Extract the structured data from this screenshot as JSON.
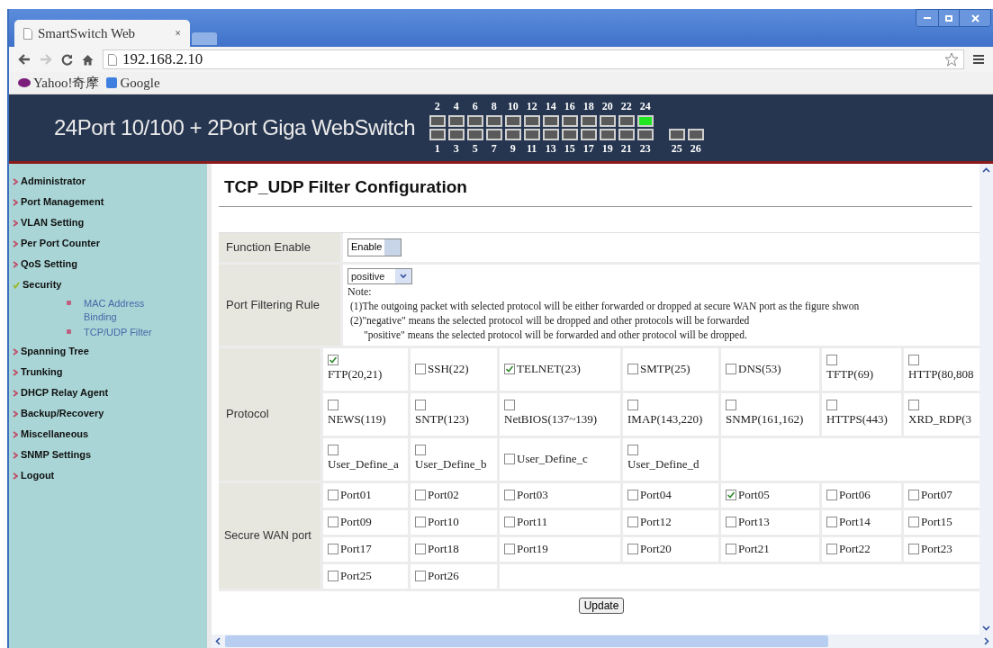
{
  "browser": {
    "tab_title": "SmartSwitch Web",
    "tab_close": "×",
    "url": "192.168.2.10",
    "bookmarks": [
      {
        "label": "Yahoo!奇摩",
        "kind": "yahoo"
      },
      {
        "label": "Google",
        "kind": "google"
      }
    ]
  },
  "banner": {
    "title": "24Port 10/100 + 2Port Giga WebSwitch",
    "ports_top": [
      {
        "label": "2",
        "up": false
      },
      {
        "label": "4",
        "up": false
      },
      {
        "label": "6",
        "up": false
      },
      {
        "label": "8",
        "up": false
      },
      {
        "label": "10",
        "up": false
      },
      {
        "label": "12",
        "up": false
      },
      {
        "label": "14",
        "up": false
      },
      {
        "label": "16",
        "up": false
      },
      {
        "label": "18",
        "up": false
      },
      {
        "label": "20",
        "up": false
      },
      {
        "label": "22",
        "up": false
      },
      {
        "label": "24",
        "up": true
      }
    ],
    "ports_bottom": [
      {
        "label": "1",
        "up": false
      },
      {
        "label": "3",
        "up": false
      },
      {
        "label": "5",
        "up": false
      },
      {
        "label": "7",
        "up": false
      },
      {
        "label": "9",
        "up": false
      },
      {
        "label": "11",
        "up": false
      },
      {
        "label": "13",
        "up": false
      },
      {
        "label": "15",
        "up": false
      },
      {
        "label": "17",
        "up": false
      },
      {
        "label": "19",
        "up": false
      },
      {
        "label": "21",
        "up": false
      },
      {
        "label": "23",
        "up": false
      }
    ],
    "ports_giga": [
      {
        "label": "25",
        "up": false
      },
      {
        "label": "26",
        "up": false
      }
    ]
  },
  "sidebar": {
    "items": [
      {
        "label": "Administrator",
        "expanded": false
      },
      {
        "label": "Port Management",
        "expanded": false
      },
      {
        "label": "VLAN Setting",
        "expanded": false
      },
      {
        "label": "Per Port Counter",
        "expanded": false
      },
      {
        "label": "QoS Setting",
        "expanded": false
      },
      {
        "label": "Security",
        "expanded": true,
        "children": [
          {
            "label": "MAC Address Binding"
          },
          {
            "label": "TCP/UDP Filter"
          }
        ]
      },
      {
        "label": "Spanning Tree",
        "expanded": false
      },
      {
        "label": "Trunking",
        "expanded": false
      },
      {
        "label": "DHCP Relay Agent",
        "expanded": false
      },
      {
        "label": "Backup/Recovery",
        "expanded": false
      },
      {
        "label": "Miscellaneous",
        "expanded": false
      },
      {
        "label": "SNMP Settings",
        "expanded": false
      },
      {
        "label": "Logout",
        "expanded": false
      }
    ]
  },
  "page_title": "TCP_UDP Filter Configuration",
  "function_enable": {
    "label": "Function Enable",
    "value": "Enable",
    "disabled": true
  },
  "port_filtering_rule": {
    "label": "Port Filtering Rule",
    "value": "positive",
    "note_title": "Note:",
    "notes": [
      "(1)The outgoing packet with selected protocol will be either forwarded or dropped at secure WAN port as the figure shwon",
      "(2)\"negative\" means the selected protocol will be dropped and other protocols will be forwarded",
      "\"positive\" means the selected protocol will be forwarded and other protocol will be dropped."
    ]
  },
  "protocol": {
    "label": "Protocol",
    "rows": [
      [
        {
          "label": "FTP(20,21)",
          "checked": true,
          "kind": "stacked"
        },
        {
          "label": "SSH(22)",
          "checked": false,
          "kind": "inline"
        },
        {
          "label": "TELNET(23)",
          "checked": true,
          "kind": "inline"
        },
        {
          "label": "SMTP(25)",
          "checked": false,
          "kind": "inline"
        },
        {
          "label": "DNS(53)",
          "checked": false,
          "kind": "inline"
        },
        {
          "label": "TFTP(69)",
          "checked": false,
          "kind": "stacked"
        },
        {
          "label": "HTTP(80,808",
          "checked": false,
          "kind": "stacked"
        }
      ],
      [
        {
          "label": "NEWS(119)",
          "checked": false,
          "kind": "stacked"
        },
        {
          "label": "SNTP(123)",
          "checked": false,
          "kind": "stacked"
        },
        {
          "label": "NetBIOS(137~139)",
          "checked": false,
          "kind": "stacked"
        },
        {
          "label": "IMAP(143,220)",
          "checked": false,
          "kind": "stacked"
        },
        {
          "label": "SNMP(161,162)",
          "checked": false,
          "kind": "stacked"
        },
        {
          "label": "HTTPS(443)",
          "checked": false,
          "kind": "stacked"
        },
        {
          "label": "XRD_RDP(3",
          "checked": false,
          "kind": "stacked"
        }
      ],
      [
        {
          "label": "User_Define_a",
          "checked": false,
          "kind": "stacked"
        },
        {
          "label": "User_Define_b",
          "checked": false,
          "kind": "stacked"
        },
        {
          "label": "User_Define_c",
          "checked": false,
          "kind": "inline"
        },
        {
          "label": "User_Define_d",
          "checked": false,
          "kind": "stacked"
        }
      ]
    ]
  },
  "secure_wan_port": {
    "label": "Secure WAN port",
    "rows": [
      [
        {
          "label": "Port01",
          "checked": false
        },
        {
          "label": "Port02",
          "checked": false
        },
        {
          "label": "Port03",
          "checked": false
        },
        {
          "label": "Port04",
          "checked": false
        },
        {
          "label": "Port05",
          "checked": true
        },
        {
          "label": "Port06",
          "checked": false
        },
        {
          "label": "Port07",
          "checked": false
        }
      ],
      [
        {
          "label": "Port09",
          "checked": false
        },
        {
          "label": "Port10",
          "checked": false
        },
        {
          "label": "Port11",
          "checked": false
        },
        {
          "label": "Port12",
          "checked": false
        },
        {
          "label": "Port13",
          "checked": false
        },
        {
          "label": "Port14",
          "checked": false
        },
        {
          "label": "Port15",
          "checked": false
        }
      ],
      [
        {
          "label": "Port17",
          "checked": false
        },
        {
          "label": "Port18",
          "checked": false
        },
        {
          "label": "Port19",
          "checked": false
        },
        {
          "label": "Port20",
          "checked": false
        },
        {
          "label": "Port21",
          "checked": false
        },
        {
          "label": "Port22",
          "checked": false
        },
        {
          "label": "Port23",
          "checked": false
        }
      ],
      [
        {
          "label": "Port25",
          "checked": false
        },
        {
          "label": "Port26",
          "checked": false
        }
      ]
    ]
  },
  "update_button": "Update"
}
